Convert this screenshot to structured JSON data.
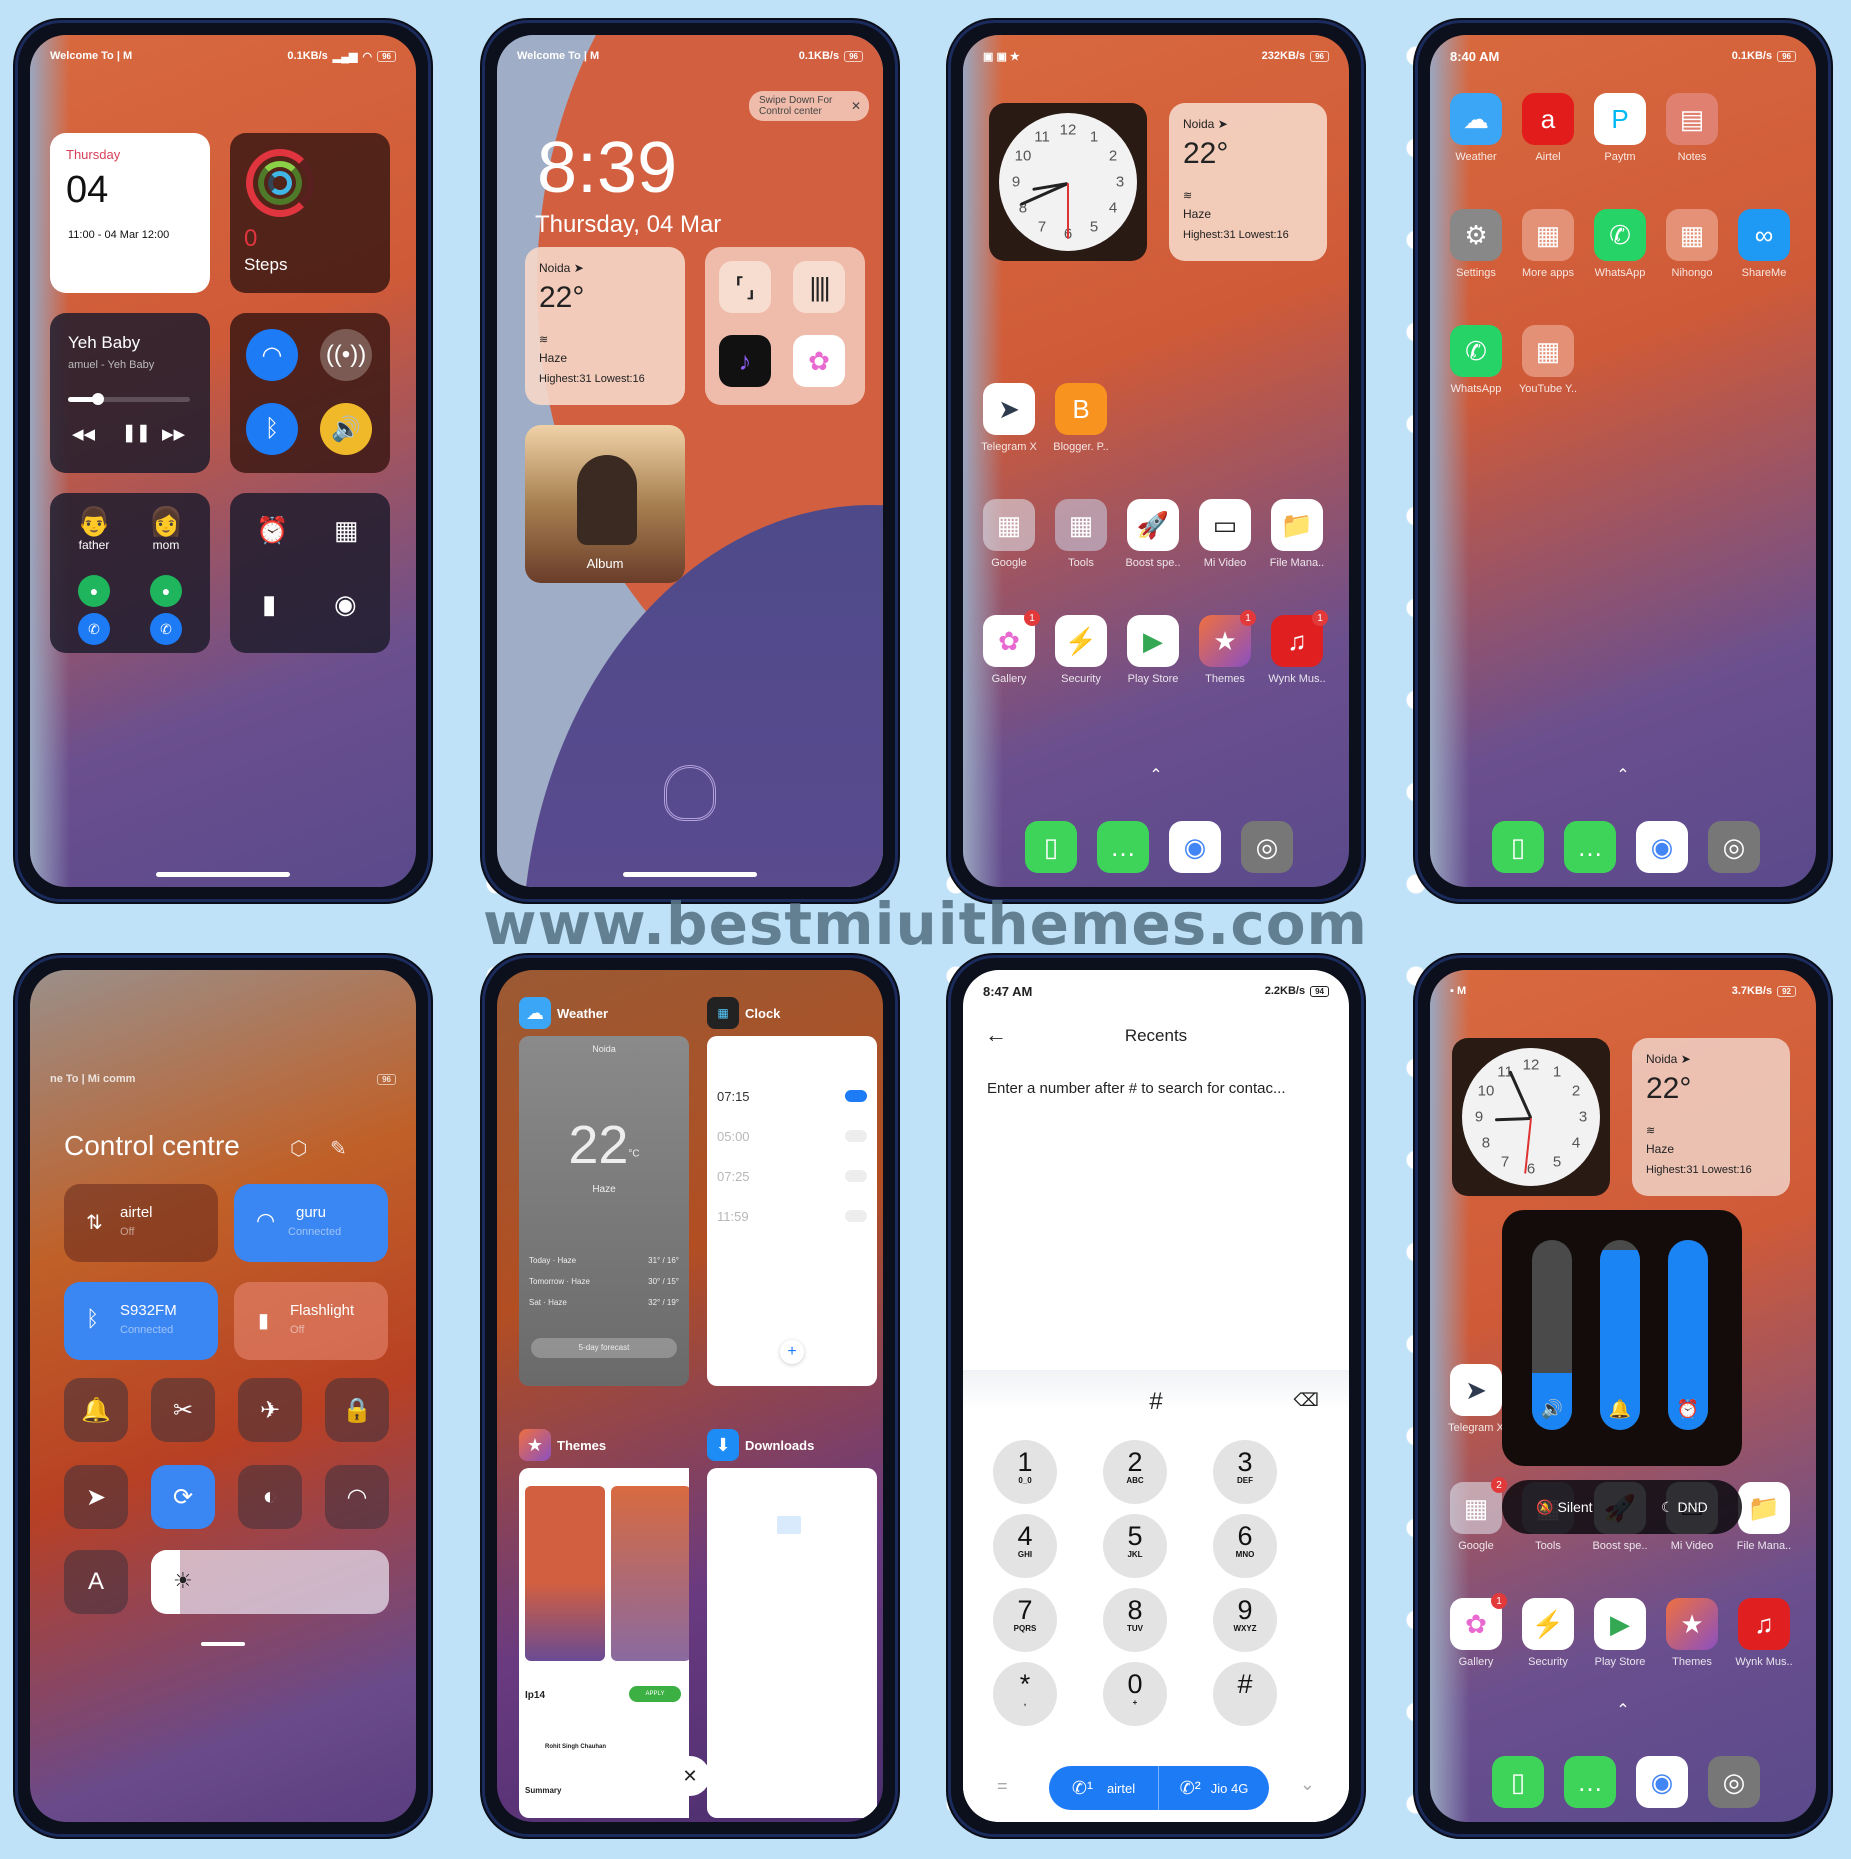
{
  "watermark": "www.bestmiuithemes.com",
  "phone1": {
    "status": {
      "left": "Welcome To | M",
      "net": "0.1KB/s",
      "battery": "96"
    },
    "calendar": {
      "day": "Thursday",
      "date": "04",
      "event": "11:00 - 04 Mar 12:00"
    },
    "fitness": {
      "steps_value": "0",
      "steps_label": "Steps"
    },
    "music": {
      "title": "Yeh Baby",
      "artist": "amuel - Yeh Baby",
      "progress": 0.25
    },
    "toggles": {
      "wifi": "on",
      "hotspot": "off",
      "bluetooth": "on",
      "sound": "on"
    },
    "contacts": [
      {
        "name": "father"
      },
      {
        "name": "mom"
      }
    ],
    "shortcuts": [
      "alarm",
      "calculator",
      "flashlight",
      "camera"
    ]
  },
  "phone2": {
    "status": {
      "left": "Welcome To | M",
      "net": "0.1KB/s",
      "battery": "96"
    },
    "tooltip": "Swipe Down For Control center",
    "time": "8:39",
    "date": "Thursday, 04 Mar",
    "weather": {
      "city": "Noida",
      "temp": "22°",
      "cond": "Haze",
      "range": "Highest:31 Lowest:16"
    },
    "album_label": "Album"
  },
  "phone3": {
    "status": {
      "net": "232KB/s",
      "battery": "96"
    },
    "weather": {
      "city": "Noida",
      "temp": "22°",
      "cond": "Haze",
      "range": "Highest:31 Lowest:16"
    },
    "row1": [
      {
        "label": "Telegram X",
        "icon": "telegram-icon"
      },
      {
        "label": "Blogger. P..",
        "icon": "blogger-icon"
      }
    ],
    "row2": [
      {
        "label": "Google"
      },
      {
        "label": "Tools"
      },
      {
        "label": "Boost spe.."
      },
      {
        "label": "Mi Video"
      },
      {
        "label": "File Mana.."
      }
    ],
    "row3": [
      {
        "label": "Gallery",
        "badge": "1"
      },
      {
        "label": "Security"
      },
      {
        "label": "Play Store"
      },
      {
        "label": "Themes",
        "badge": "1"
      },
      {
        "label": "Wynk Mus..",
        "badge": "1"
      }
    ],
    "dock": [
      "phone",
      "messages",
      "chrome",
      "camera"
    ]
  },
  "phone4": {
    "status": {
      "time": "8:40 AM",
      "net": "0.1KB/s",
      "battery": "96"
    },
    "row1": [
      {
        "label": "Weather"
      },
      {
        "label": "Airtel"
      },
      {
        "label": "Paytm"
      },
      {
        "label": "Notes"
      }
    ],
    "row2": [
      {
        "label": "Settings"
      },
      {
        "label": "More apps"
      },
      {
        "label": "WhatsApp"
      },
      {
        "label": "Nihongo"
      },
      {
        "label": "ShareMe"
      }
    ],
    "row3": [
      {
        "label": "WhatsApp"
      },
      {
        "label": "YouTube Y.."
      }
    ],
    "dock": [
      "phone",
      "messages",
      "chrome",
      "camera"
    ]
  },
  "phone5": {
    "status": {
      "left": "ne To | Mi comm",
      "battery": "96"
    },
    "title": "Control centre",
    "tiles": {
      "mobile": {
        "name": "airtel",
        "state": "Off"
      },
      "wifi": {
        "name": "guru",
        "state": "Connected"
      },
      "bluetooth": {
        "name": "S932FM",
        "state": "Connected"
      },
      "flashlight": {
        "name": "Flashlight",
        "state": "Off"
      }
    },
    "auto_brightness_label": "A",
    "brightness": 0.12
  },
  "phone6": {
    "apps": [
      {
        "name": "Weather",
        "city": "Noida",
        "temp": "22",
        "unit": "°C",
        "cond": "Haze",
        "forecast": [
          {
            "day": "Today · Haze",
            "range": "31° / 16°"
          },
          {
            "day": "Tomorrow · Haze",
            "range": "30° / 15°"
          },
          {
            "day": "Sat · Haze",
            "range": "32° / 19°"
          }
        ],
        "button": "5-day forecast"
      },
      {
        "name": "Clock",
        "alarms": [
          {
            "time": "07:15",
            "on": true
          },
          {
            "time": "05:00",
            "on": false
          },
          {
            "time": "07:25",
            "on": false
          },
          {
            "time": "11:59",
            "on": false
          }
        ]
      },
      {
        "name": "Themes",
        "theme_name": "Ip14",
        "apply": "APPLY",
        "author": "Rohit Singh Chauhan",
        "summary": "Summary"
      },
      {
        "name": "Downloads"
      }
    ]
  },
  "phone7": {
    "status": {
      "time": "8:47 AM",
      "net": "2.2KB/s",
      "battery": "94"
    },
    "title": "Recents",
    "hint": "Enter a number after # to search for contac...",
    "input": "#",
    "keys": [
      {
        "d": "1",
        "s": "0_0"
      },
      {
        "d": "2",
        "s": "ABC"
      },
      {
        "d": "3",
        "s": "DEF"
      },
      {
        "d": "4",
        "s": "GHI"
      },
      {
        "d": "5",
        "s": "JKL"
      },
      {
        "d": "6",
        "s": "MNO"
      },
      {
        "d": "7",
        "s": "PQRS"
      },
      {
        "d": "8",
        "s": "TUV"
      },
      {
        "d": "9",
        "s": "WXYZ"
      },
      {
        "d": "*",
        "s": ","
      },
      {
        "d": "0",
        "s": "+"
      },
      {
        "d": "#",
        "s": ""
      }
    ],
    "sim1": "airtel",
    "sim2": "Jio 4G"
  },
  "phone8": {
    "status": {
      "net": "3.7KB/s",
      "battery": "92"
    },
    "weather": {
      "city": "Noida",
      "temp": "22°",
      "cond": "Haze",
      "range": "Highest:31 Lowest:16"
    },
    "volume": [
      {
        "name": "media",
        "level": 0.3
      },
      {
        "name": "ring",
        "level": 0.95
      },
      {
        "name": "alarm",
        "level": 1.0
      }
    ],
    "silent_label": "Silent",
    "dnd_label": "DND",
    "row2": [
      {
        "label": "Google",
        "badge": "2"
      },
      {
        "label": "Tools"
      },
      {
        "label": "Boost spe.."
      },
      {
        "label": "Mi Video"
      },
      {
        "label": "File Mana.."
      }
    ],
    "row3": [
      {
        "label": "Gallery",
        "badge": "1"
      },
      {
        "label": "Security"
      },
      {
        "label": "Play Store"
      },
      {
        "label": "Themes"
      },
      {
        "label": "Wynk Mus.."
      }
    ],
    "telegram_label": "Telegram X",
    "dock": [
      "phone",
      "messages",
      "chrome",
      "camera"
    ]
  }
}
